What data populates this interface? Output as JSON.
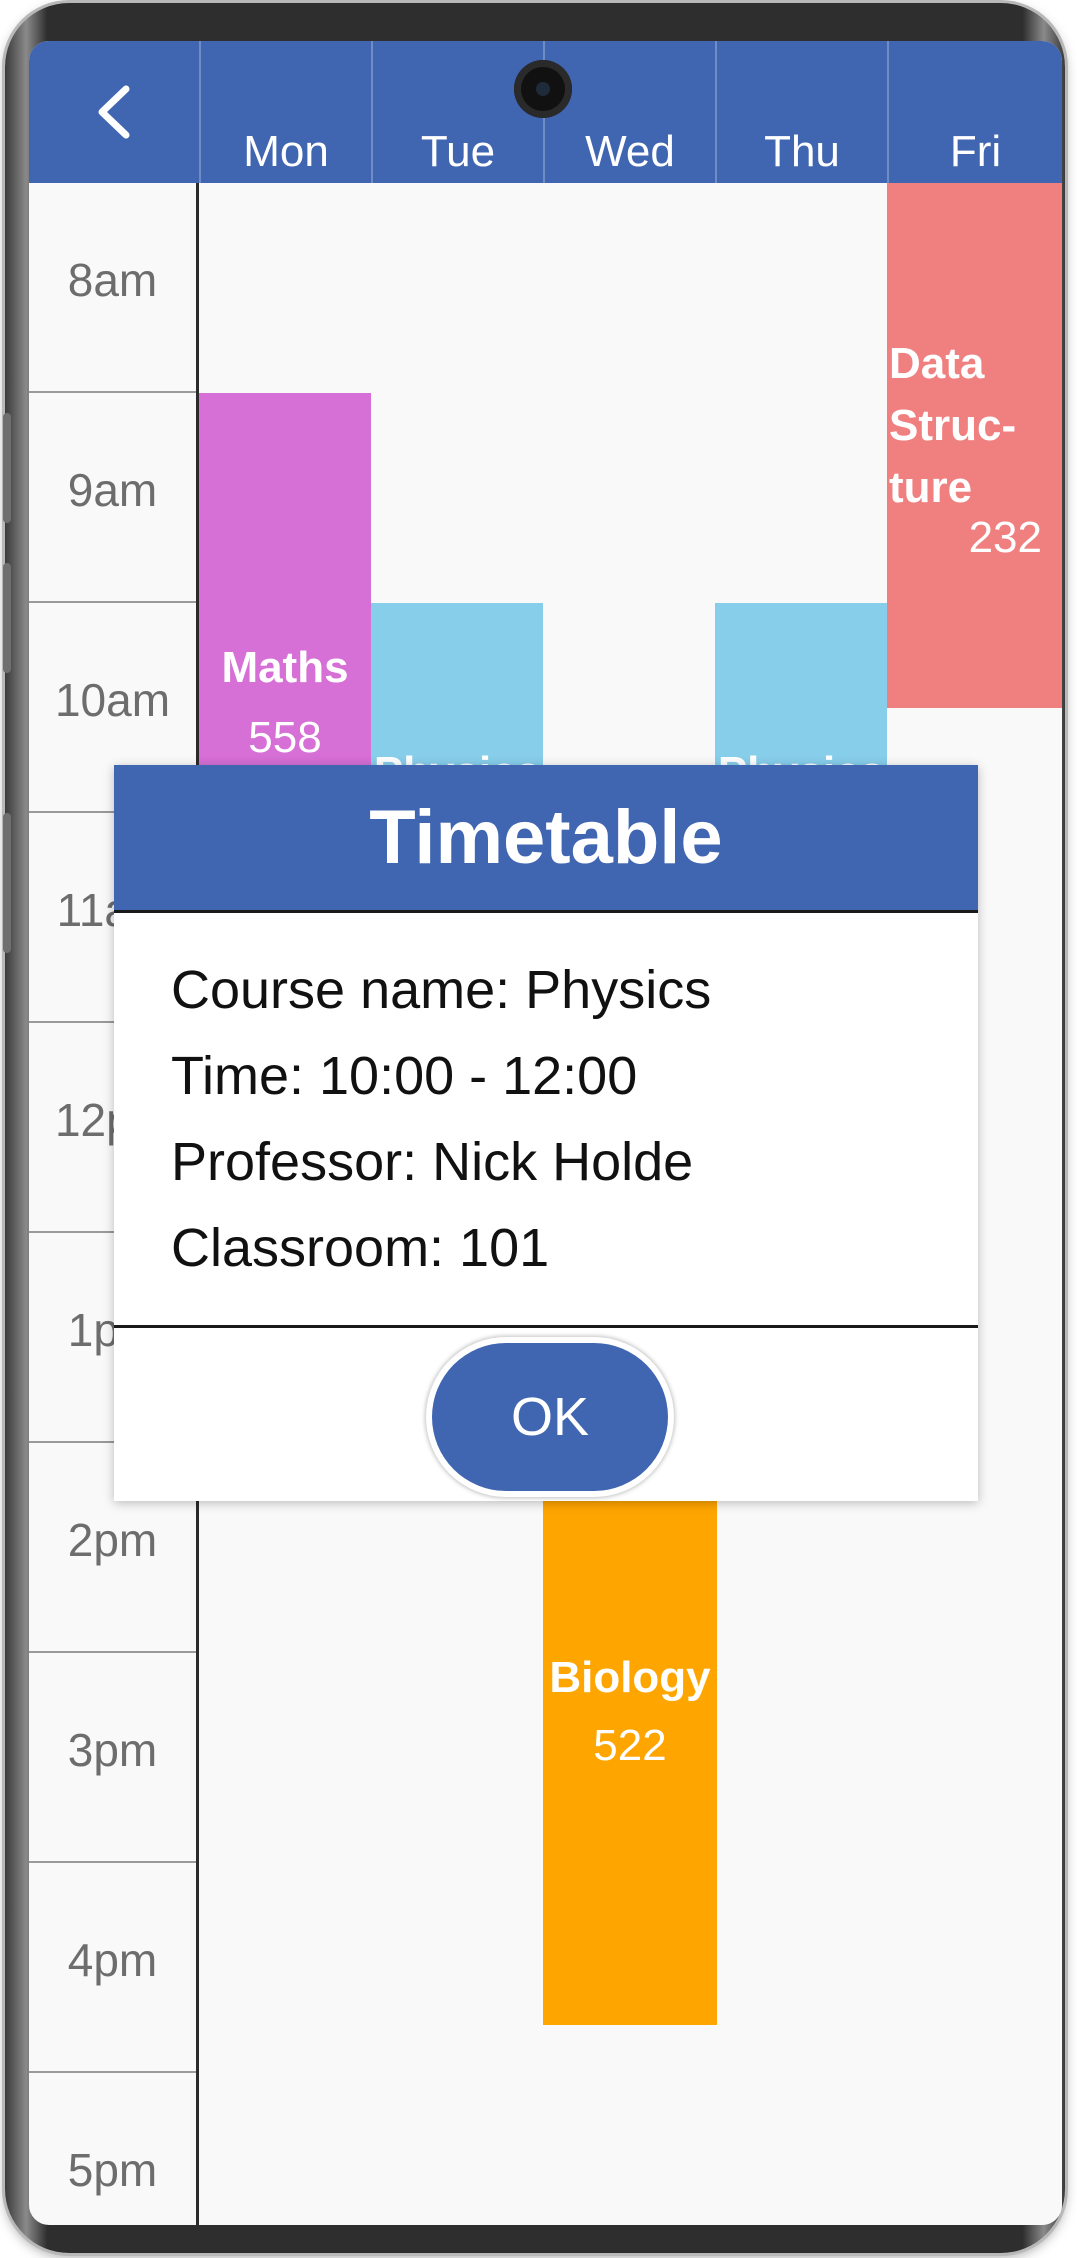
{
  "header": {
    "back_icon": "chevron-left-icon",
    "days": [
      "Mon",
      "Tue",
      "Wed",
      "Thu",
      "Fri"
    ]
  },
  "times": [
    "8am",
    "9am",
    "10am",
    "11am",
    "12pm",
    "1pm",
    "2pm",
    "3pm",
    "4pm",
    "5pm"
  ],
  "courses": {
    "maths": {
      "name": "Maths",
      "room": "558",
      "color": "#d66fd6"
    },
    "physics_tue": {
      "name": "Physics",
      "color": "#87ceeb"
    },
    "physics_thu": {
      "name": "Physics",
      "color": "#87ceeb"
    },
    "data_structure": {
      "name": "Data\nStruc-\nture",
      "room": "232",
      "color": "#f08080"
    },
    "biology": {
      "name": "Biology",
      "room": "522",
      "color": "#ffa500"
    }
  },
  "dialog": {
    "title": "Timetable",
    "course_line": "Course name: Physics",
    "time_line": "Time: 10:00 - 12:00",
    "professor_line": "Professor: Nick Holde",
    "classroom_line": "Classroom: 101",
    "ok_label": "OK"
  },
  "colors": {
    "accent": "#4066b2",
    "background": "#f9f9f9"
  }
}
